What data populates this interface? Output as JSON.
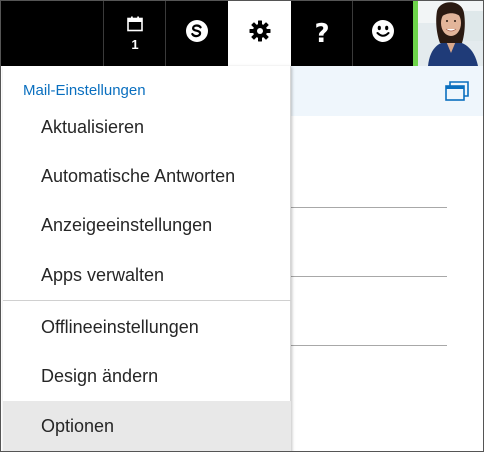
{
  "topbar": {
    "calendar": {
      "icon": "calendar-icon",
      "day": "1"
    },
    "skype": {
      "icon": "skype-icon"
    },
    "settings": {
      "icon": "gear-icon",
      "active": true
    },
    "help": {
      "icon": "question-icon",
      "label": "?"
    },
    "feedback": {
      "icon": "smiley-icon"
    },
    "avatar": {
      "icon": "user-avatar",
      "status_color": "#6dd44a"
    }
  },
  "settings_menu": {
    "heading": "Mail-Einstellungen",
    "items": [
      {
        "label": "Aktualisieren"
      },
      {
        "label": "Automatische Antworten"
      },
      {
        "label": "Anzeigeeinstellungen"
      },
      {
        "label": "Apps verwalten"
      },
      {
        "label": "Offlineeinstellungen"
      },
      {
        "label": "Design ändern"
      },
      {
        "label": "Optionen",
        "selected": true
      }
    ]
  },
  "content": {
    "popout_icon": "popout-window-icon"
  },
  "colors": {
    "topbar": "#000000",
    "accent": "#0a6fbf",
    "selected_item": "#e8e8e8",
    "band": "#eff6fc"
  }
}
